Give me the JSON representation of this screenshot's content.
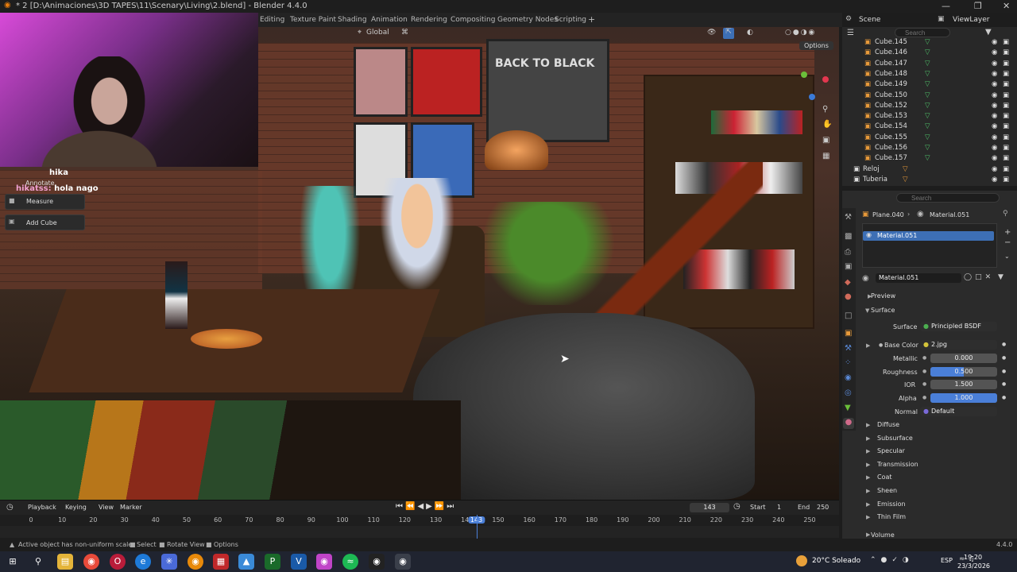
{
  "window": {
    "title": "* 2 [D:\\Animaciones\\3D TAPES\\11\\Scenary\\Living\\2.blend] - Blender 4.4.0",
    "min": "—",
    "max": "❐",
    "close": "✕"
  },
  "workspaces": [
    "Editing",
    "Texture Paint",
    "Shading",
    "Animation",
    "Rendering",
    "Compositing",
    "Geometry Nodes",
    "Scripting",
    "+"
  ],
  "scene": {
    "label": "Scene",
    "viewlayer": "ViewLayer"
  },
  "viewport_header": {
    "orientation": "Global",
    "options": "Options"
  },
  "webcam": {
    "chat": [
      {
        "user": "",
        "text": "hika"
      },
      {
        "user": "hikatss:",
        "text": "hola nago"
      }
    ]
  },
  "tools": [
    "Annotate",
    "Measure",
    "Add Cube"
  ],
  "outliner": {
    "search_placeholder": "Search",
    "items": [
      "Cube.145",
      "Cube.146",
      "Cube.147",
      "Cube.148",
      "Cube.149",
      "Cube.150",
      "Cube.152",
      "Cube.153",
      "Cube.154",
      "Cube.155",
      "Cube.156",
      "Cube.157",
      "Reloj",
      "Tuberia"
    ]
  },
  "properties": {
    "search_placeholder": "Search",
    "breadcrumb_object": "Plane.040",
    "breadcrumb_material": "Material.051",
    "slot": "Material.051",
    "material_name": "Material.051",
    "preview": "Preview",
    "surface": "Surface",
    "surface_label": "Surface",
    "surface_value": "Principled BSDF",
    "base_color_label": "Base Color",
    "base_color_value": "2.jpg",
    "metallic_label": "Metallic",
    "metallic_value": "0.000",
    "roughness_label": "Roughness",
    "roughness_value": "0.500",
    "roughness": 0.5,
    "ior_label": "IOR",
    "ior_value": "1.500",
    "alpha_label": "Alpha",
    "alpha_value": "1.000",
    "alpha": 1.0,
    "normal_label": "Normal",
    "normal_value": "Default",
    "sections": [
      "Diffuse",
      "Subsurface",
      "Specular",
      "Transmission",
      "Coat",
      "Sheen",
      "Emission",
      "Thin Film",
      "Volume"
    ]
  },
  "timeline": {
    "menus": [
      "Playback",
      "Keying",
      "View",
      "Marker"
    ],
    "current_frame": "143",
    "start_label": "Start",
    "start": "1",
    "end_label": "End",
    "end": "250",
    "ticks": [
      "0",
      "10",
      "20",
      "30",
      "40",
      "50",
      "60",
      "70",
      "80",
      "90",
      "100",
      "110",
      "120",
      "130",
      "140",
      "143",
      "150",
      "160",
      "170",
      "180",
      "190",
      "200",
      "210",
      "220",
      "230",
      "240",
      "250"
    ]
  },
  "statusbar": {
    "message": "Active object has non-uniform scale",
    "select": "Select",
    "rotate": "Rotate View",
    "options": "Options",
    "version": "4.4.0"
  },
  "taskbar": {
    "weather": "20°C  Soleado",
    "lang": "ESP",
    "time": "19:20",
    "date": "23/3/2026"
  },
  "scene_text": {
    "poster": "BACK TO BLACK"
  }
}
